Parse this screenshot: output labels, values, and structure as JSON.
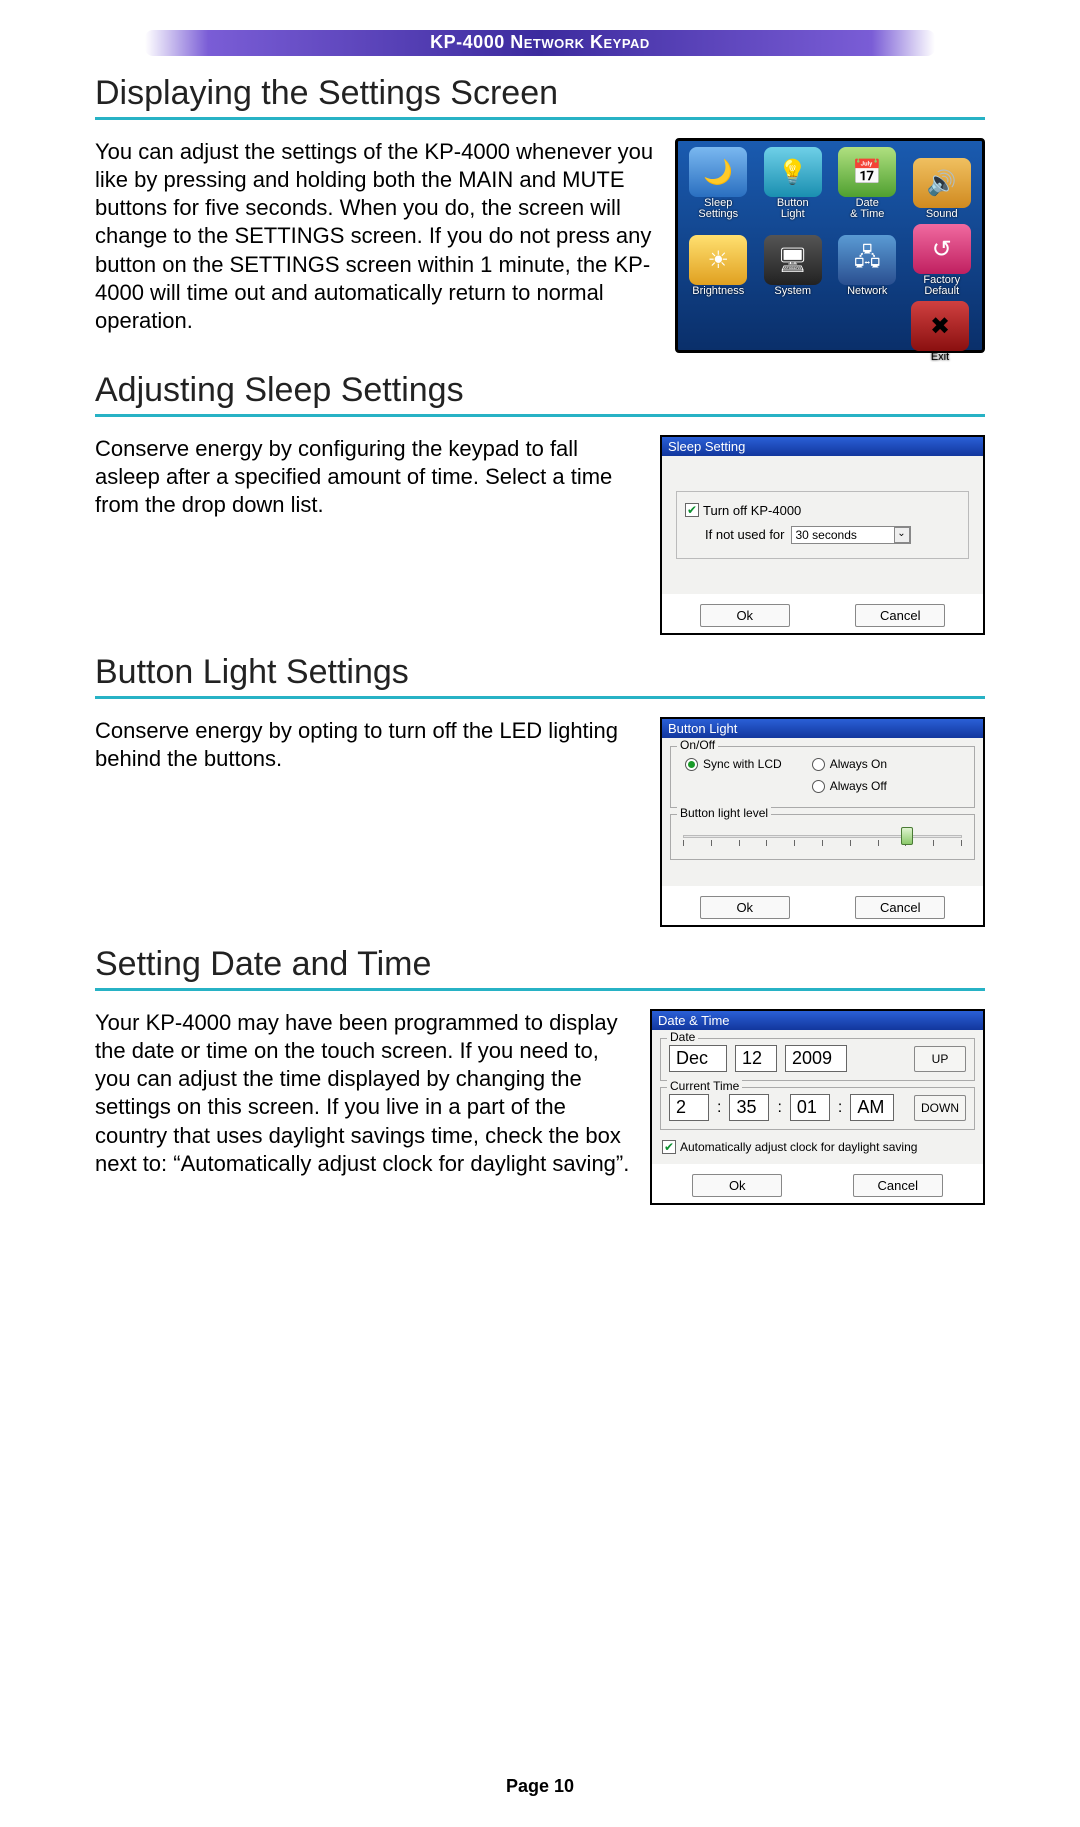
{
  "banner": "KP-4000 Network Keypad",
  "sections": {
    "s1": {
      "heading": "Displaying the Settings Screen",
      "text": "You can adjust the settings of the KP-4000 whenever you like by pressing and holding both the MAIN and MUTE buttons for five seconds. When you do, the screen will change to the SETTINGS screen. If you do not press any button on the SETTINGS screen within 1 minute, the KP-4000 will time out and automatically return to normal operation."
    },
    "s2": {
      "heading": "Adjusting Sleep Settings",
      "text": "Conserve energy by configuring the keypad to fall asleep after a specified amount of time. Select a time from the drop down list."
    },
    "s3": {
      "heading": "Button Light Settings",
      "text": "Conserve energy by opting to turn off the LED lighting behind the buttons."
    },
    "s4": {
      "heading": "Setting Date and Time",
      "text": "Your KP-4000 may have been programmed to display the date or time on the touch screen. If you need to, you can adjust the time displayed by changing the settings on this screen. If you live in a part of the country that uses daylight savings time, check the box next to: “Automatically adjust clock for daylight saving”."
    }
  },
  "fig1": {
    "cells": [
      {
        "label": "Sleep\nSettings",
        "glyph": "🌙",
        "bg": "linear-gradient(#7ab8f0,#2a6fc0)"
      },
      {
        "label": "Button\nLight",
        "glyph": "💡",
        "bg": "linear-gradient(#6fd0e8,#1a8fb0)"
      },
      {
        "label": "Date\n& Time",
        "glyph": "📅",
        "bg": "linear-gradient(#b0e080,#4fa030)"
      },
      {
        "label": "Sound",
        "glyph": "🔊",
        "bg": "linear-gradient(#f0c060,#d08a20)"
      },
      {
        "label": "Brightness",
        "glyph": "☀",
        "bg": "linear-gradient(#ffe070,#e0a020)"
      },
      {
        "label": "System",
        "glyph": "🖥",
        "bg": "linear-gradient(#555,#222)"
      },
      {
        "label": "Network",
        "glyph": "🖧",
        "bg": "linear-gradient(#5a9bd4,#2a4f90)"
      },
      {
        "label": "Factory Default",
        "glyph": "↺",
        "bg": "linear-gradient(#f06aa0,#c02060)"
      }
    ],
    "exit": {
      "label": "Exit",
      "glyph": "✖",
      "bg": "linear-gradient(#d04040,#8a1010)"
    }
  },
  "sleep_dialog": {
    "title": "Sleep Setting",
    "checkbox": "Turn off KP-4000",
    "if_not_used": "If not used for",
    "value": "30 seconds",
    "ok": "Ok",
    "cancel": "Cancel"
  },
  "light_dialog": {
    "title": "Button Light",
    "group1": "On/Off",
    "sync": "Sync with LCD",
    "always_on": "Always On",
    "always_off": "Always Off",
    "group2": "Button light level",
    "ok": "Ok",
    "cancel": "Cancel"
  },
  "dt_dialog": {
    "title": "Date & Time",
    "date_label": "Date",
    "month": "Dec",
    "day": "12",
    "year": "2009",
    "up": "UP",
    "time_label": "Current Time",
    "h": "2",
    "m": "35",
    "s": "01",
    "ampm": "AM",
    "down": "DOWN",
    "dst": "Automatically adjust clock for daylight saving",
    "ok": "Ok",
    "cancel": "Cancel"
  },
  "footer": "Page 10"
}
